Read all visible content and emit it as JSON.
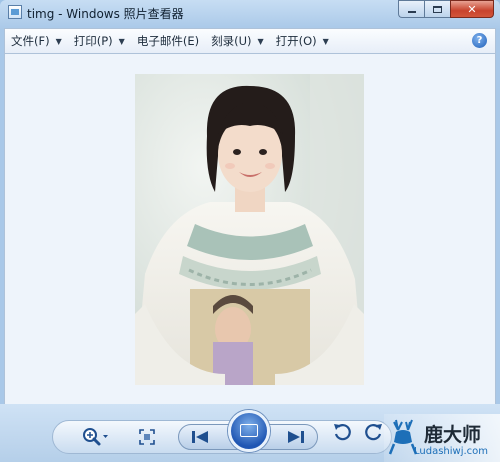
{
  "window": {
    "title": "timg - Windows 照片查看器"
  },
  "menu": {
    "items": [
      {
        "label": "文件(F)",
        "has_dropdown": true
      },
      {
        "label": "打印(P)",
        "has_dropdown": true
      },
      {
        "label": "电子邮件(E)",
        "has_dropdown": false
      },
      {
        "label": "刻录(U)",
        "has_dropdown": true
      },
      {
        "label": "打开(O)",
        "has_dropdown": true
      }
    ],
    "help_icon": "help-icon"
  },
  "toolbar": {
    "icons": [
      "zoom-icon",
      "actual-size-icon",
      "previous-icon",
      "slideshow-icon",
      "next-icon",
      "rotate-counterclockwise-icon",
      "rotate-clockwise-icon"
    ]
  },
  "watermark": {
    "text": "鹿大师",
    "subtext": "Ludashiwj.com"
  },
  "colors": {
    "close_button": "#c8432d",
    "slideshow_button": "#1f56b3",
    "viewer_bg": "#eef4fb"
  }
}
